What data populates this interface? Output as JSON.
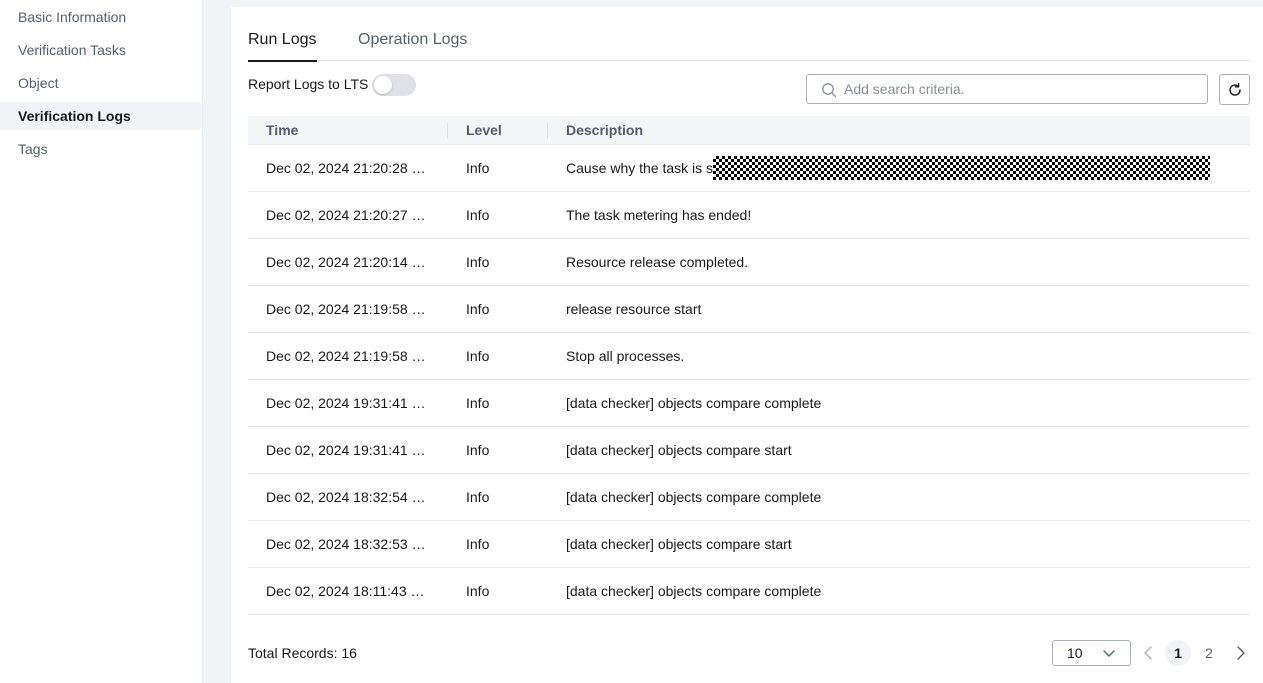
{
  "sidebar": {
    "items": [
      {
        "label": "Basic Information"
      },
      {
        "label": "Verification Tasks"
      },
      {
        "label": "Object"
      },
      {
        "label": "Verification Logs",
        "active": true
      },
      {
        "label": "Tags"
      }
    ]
  },
  "tabs": [
    {
      "label": "Run Logs",
      "active": true
    },
    {
      "label": "Operation Logs"
    }
  ],
  "toolbar": {
    "lts_label": "Report Logs to LTS",
    "lts_enabled": false,
    "search_placeholder": "Add search criteria.",
    "refresh_icon": "refresh-icon"
  },
  "table": {
    "columns": [
      "Time",
      "Level",
      "Description"
    ],
    "rows": [
      {
        "time": "Dec 02, 2024 21:20:28 G...",
        "level": "Info",
        "description": "Cause why the task is sto"
      },
      {
        "time": "Dec 02, 2024 21:20:27 G...",
        "level": "Info",
        "description": "The task metering has ended!"
      },
      {
        "time": "Dec 02, 2024 21:20:14 G...",
        "level": "Info",
        "description": "Resource release completed."
      },
      {
        "time": "Dec 02, 2024 21:19:58 G...",
        "level": "Info",
        "description": "release resource start"
      },
      {
        "time": "Dec 02, 2024 21:19:58 G...",
        "level": "Info",
        "description": "Stop all processes."
      },
      {
        "time": "Dec 02, 2024 19:31:41 G...",
        "level": "Info",
        "description": "[data checker] objects compare complete"
      },
      {
        "time": "Dec 02, 2024 19:31:41 G...",
        "level": "Info",
        "description": "[data checker] objects compare start"
      },
      {
        "time": "Dec 02, 2024 18:32:54 G...",
        "level": "Info",
        "description": "[data checker] objects compare complete"
      },
      {
        "time": "Dec 02, 2024 18:32:53 G...",
        "level": "Info",
        "description": "[data checker] objects compare start"
      },
      {
        "time": "Dec 02, 2024 18:11:43 G...",
        "level": "Info",
        "description": "[data checker] objects compare complete"
      }
    ]
  },
  "footer": {
    "total_records": "Total Records: 16",
    "page_size": "10",
    "pages": [
      "1",
      "2"
    ],
    "current_page": "1"
  },
  "colors": {
    "background": "#f1f3f6",
    "text": "#191919",
    "muted": "#575d6c",
    "border": "#e4e7ec"
  }
}
